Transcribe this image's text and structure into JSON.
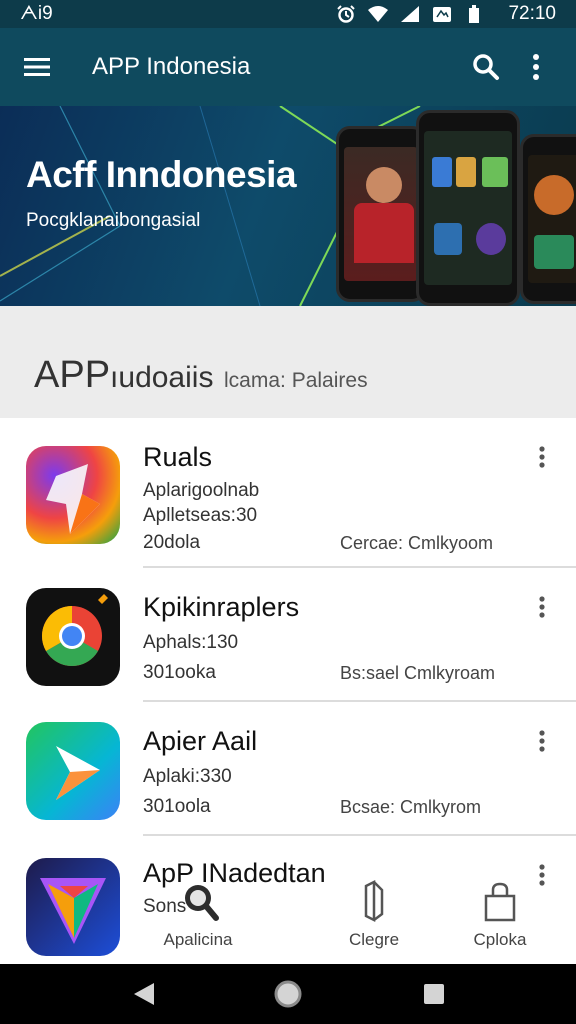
{
  "status_bar": {
    "left_text": "ᗅi9",
    "time": "72:10"
  },
  "app_bar": {
    "title": "APP Indonesia"
  },
  "banner": {
    "title": "Acff Inndonesia",
    "subtitle": "Pocgklanaibongasial"
  },
  "section": {
    "title": "APP",
    "title_rest": "ıudoaiis",
    "small": "lcama: Palaires"
  },
  "apps": [
    {
      "name": "Ruals",
      "line1": "Aplarigoolnab",
      "line2": "Aplletseas:30",
      "line3": "20dola",
      "meta": "Cercae: Cmlkyoom",
      "icon": "colorful-star-icon"
    },
    {
      "name": "Kpikinraplers",
      "line1": "Aphals:130",
      "line3": "301ooka",
      "meta": "Bs:sael Cmlkyroam",
      "icon": "browser-icon"
    },
    {
      "name": "Apier Aail",
      "line1": "Aplaki:330",
      "line3": "301oola",
      "meta": "Bcsae: Cmlkyrom",
      "icon": "play-arrow-icon"
    },
    {
      "name": "ApP INadedtan",
      "line1": "Sons",
      "icon": "shield-gem-icon"
    }
  ],
  "bottom_tabs": [
    {
      "label": "Apalicina",
      "icon": "search-magnifier-icon"
    },
    {
      "label": "Clegre",
      "icon": "book-icon"
    },
    {
      "label": "Cploka",
      "icon": "bag-icon"
    }
  ],
  "colors": {
    "status_bar": "#0d3b4a",
    "app_bar": "#0f4a5e",
    "section_bg": "#ececec",
    "nav_bar": "#000000"
  }
}
